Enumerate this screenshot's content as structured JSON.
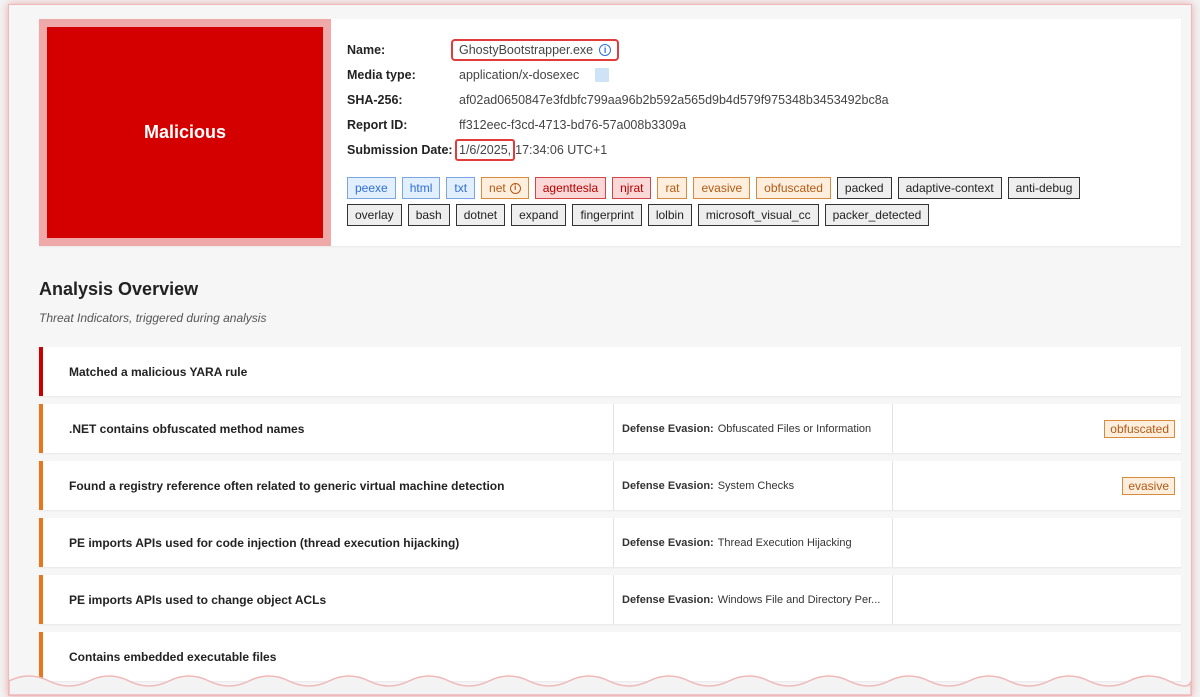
{
  "verdict": {
    "label": "Malicious",
    "color": "#d40000"
  },
  "meta": {
    "name_label": "Name:",
    "name_value": "GhostyBootstrapper.exe",
    "media_label": "Media type:",
    "media_value": "application/x-dosexec",
    "sha_label": "SHA-256:",
    "sha_value": "af02ad0650847e3fdbfc799aa96b2b592a565d9b4d579f975348b3453492bc8a",
    "report_label": "Report ID:",
    "report_value": "ff312eec-f3cd-4713-bd76-57a008b3309a",
    "date_label": "Submission Date:",
    "date_value": "1/6/2025,",
    "time_value": "17:34:06 UTC+1"
  },
  "tags": {
    "row1": [
      {
        "label": "peexe",
        "style": "blue"
      },
      {
        "label": "html",
        "style": "blue"
      },
      {
        "label": "txt",
        "style": "blue"
      },
      {
        "label": "net",
        "style": "orange",
        "icon": "info-icon"
      },
      {
        "label": "agenttesla",
        "style": "red"
      },
      {
        "label": "njrat",
        "style": "red"
      },
      {
        "label": "rat",
        "style": "orange"
      },
      {
        "label": "evasive",
        "style": "orange"
      },
      {
        "label": "obfuscated",
        "style": "orange"
      },
      {
        "label": "packed",
        "style": "gray"
      },
      {
        "label": "adaptive-context",
        "style": "gray"
      },
      {
        "label": "anti-debug",
        "style": "gray"
      }
    ],
    "row2": [
      {
        "label": "overlay",
        "style": "gray"
      },
      {
        "label": "bash",
        "style": "gray"
      },
      {
        "label": "dotnet",
        "style": "gray"
      },
      {
        "label": "expand",
        "style": "gray"
      },
      {
        "label": "fingerprint",
        "style": "gray"
      },
      {
        "label": "lolbin",
        "style": "gray"
      },
      {
        "label": "microsoft_visual_cc",
        "style": "gray"
      },
      {
        "label": "packer_detected",
        "style": "gray"
      }
    ]
  },
  "overview": {
    "title": "Analysis Overview",
    "subtitle": "Threat Indicators, triggered during analysis",
    "indicators": [
      {
        "title": "Matched a malicious YARA rule",
        "severity": "red",
        "tactic": "",
        "technique": "",
        "tag": ""
      },
      {
        "title": ".NET contains obfuscated method names",
        "severity": "orange",
        "tactic": "Defense Evasion:",
        "technique": "Obfuscated Files or Information",
        "tag": "obfuscated"
      },
      {
        "title": "Found a registry reference often related to generic virtual machine detection",
        "severity": "orange",
        "tactic": "Defense Evasion:",
        "technique": "System Checks",
        "tag": "evasive"
      },
      {
        "title": "PE imports APIs used for code injection (thread execution hijacking)",
        "severity": "orange",
        "tactic": "Defense Evasion:",
        "technique": "Thread Execution Hijacking",
        "tag": ""
      },
      {
        "title": "PE imports APIs used to change object ACLs",
        "severity": "orange",
        "tactic": "Defense Evasion:",
        "technique": "Windows File and Directory Per...",
        "tag": ""
      },
      {
        "title": "Contains embedded executable files",
        "severity": "orange",
        "tactic": "",
        "technique": "",
        "tag": ""
      }
    ]
  }
}
